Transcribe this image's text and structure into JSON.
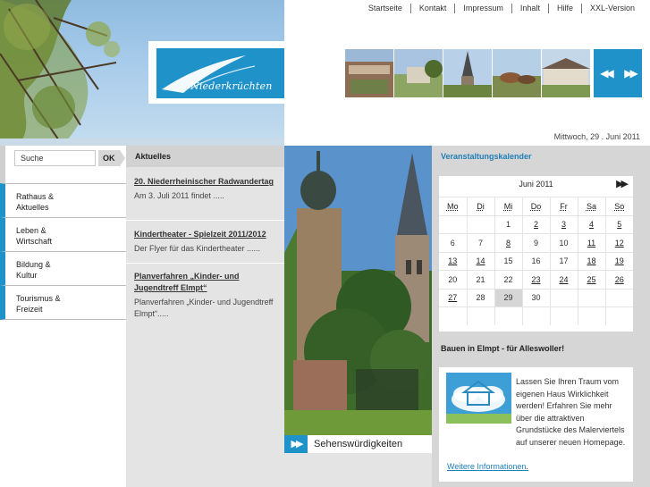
{
  "topnav": [
    "Startseite",
    "Kontakt",
    "Impressum",
    "Inhalt",
    "Hilfe",
    "XXL-Version"
  ],
  "logo": {
    "text": "Niederkrüchten"
  },
  "date": "Mittwoch, 29 . Juni 2011",
  "search": {
    "value": "Suche",
    "button": "OK"
  },
  "nav": [
    [
      "Rathaus &",
      "Aktuelles"
    ],
    [
      "Leben &",
      "Wirtschaft"
    ],
    [
      "Bildung &",
      "Kultur"
    ],
    [
      "Tourismus &",
      "Freizeit"
    ]
  ],
  "news": {
    "heading": "Aktuelles",
    "items": [
      {
        "title": "20. Niederrheinischer Radwandertag",
        "text": "Am 3. Juli 2011 findet ....."
      },
      {
        "title": "Kindertheater - Spielzeit 2011/2012",
        "text": "Der Flyer für das Kindertheater ......"
      },
      {
        "title": "Planverfahren „Kinder- und Jugendtreff Elmpt“",
        "text": "Planverfahren „Kinder- und Jugendtreff Elmpt“....."
      }
    ]
  },
  "photo": {
    "caption": "Sehenswürdigkeiten"
  },
  "calendar": {
    "heading": "Veranstaltungskalender",
    "month": "Juni 2011",
    "weekdays": [
      "Mo",
      "Di",
      "Mi",
      "Do",
      "Fr",
      "Sa",
      "So"
    ],
    "weeks": [
      [
        "",
        "",
        "1",
        "2",
        "3",
        "4",
        "5"
      ],
      [
        "6",
        "7",
        "8",
        "9",
        "10",
        "11",
        "12"
      ],
      [
        "13",
        "14",
        "15",
        "16",
        "17",
        "18",
        "19"
      ],
      [
        "20",
        "21",
        "22",
        "23",
        "24",
        "25",
        "26"
      ],
      [
        "27",
        "28",
        "29",
        "30",
        "",
        "",
        ""
      ],
      [
        "",
        "",
        "",
        "",
        "",
        "",
        ""
      ]
    ],
    "linked_days": [
      "2",
      "3",
      "4",
      "5",
      "8",
      "11",
      "12",
      "13",
      "14",
      "18",
      "19",
      "23",
      "24",
      "25",
      "26",
      "27"
    ],
    "today": "29"
  },
  "bauen": {
    "heading": "Bauen in Elmpt - für Alleswoller!",
    "text": "Lassen Sie Ihren Traum vom eigenen Haus Wirklichkeit werden! Erfahren Sie mehr über die attraktiven Grundstücke des Malerviertels auf unserer neuen Homepage.",
    "link": "Weitere Informationen",
    "link_suffix": "."
  },
  "colors": {
    "accent": "#1f93c9",
    "panel": "#d6d6d6",
    "news_bg": "#e4e4e4"
  },
  "icons": {
    "slider": "double-arrow-left-right",
    "calendar_next": "double-arrow-right",
    "caption": "double-arrow-right"
  }
}
